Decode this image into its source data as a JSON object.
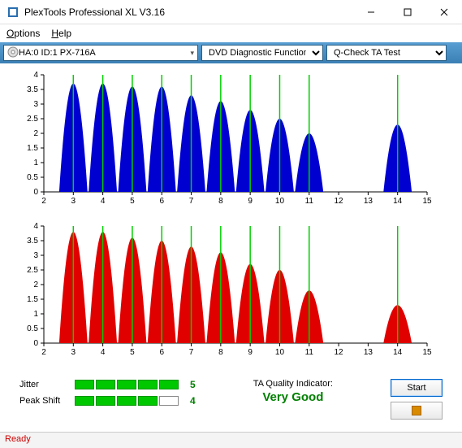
{
  "window": {
    "title": "PlexTools Professional XL V3.16"
  },
  "menu": {
    "options": "Options",
    "help": "Help"
  },
  "toolbar": {
    "drive": "HA:0 ID:1  PX-716A",
    "func": "DVD Diagnostic Functions",
    "test": "Q-Check TA Test"
  },
  "metrics": {
    "jitter_label": "Jitter",
    "jitter_segments": 5,
    "jitter_value": "5",
    "peakshift_label": "Peak Shift",
    "peakshift_segments": 4,
    "peakshift_value": "4",
    "qi_label": "TA Quality Indicator:",
    "qi_value": "Very Good"
  },
  "buttons": {
    "start": "Start"
  },
  "status": "Ready",
  "chart_data": [
    {
      "type": "bar",
      "title": "",
      "xlabel": "",
      "ylabel": "",
      "xlim": [
        2,
        15
      ],
      "ylim": [
        0,
        4
      ],
      "xticks": [
        2,
        3,
        4,
        5,
        6,
        7,
        8,
        9,
        10,
        11,
        12,
        13,
        14,
        15
      ],
      "yticks": [
        0,
        0.5,
        1,
        1.5,
        2,
        2.5,
        3,
        3.5,
        4
      ],
      "color": "#0000d0",
      "markers_x": [
        3,
        4,
        5,
        6,
        7,
        8,
        9,
        10,
        11,
        14
      ],
      "peaks": [
        {
          "x": 3,
          "h": 3.7
        },
        {
          "x": 4,
          "h": 3.7
        },
        {
          "x": 5,
          "h": 3.6
        },
        {
          "x": 6,
          "h": 3.6
        },
        {
          "x": 7,
          "h": 3.3
        },
        {
          "x": 8,
          "h": 3.1
        },
        {
          "x": 9,
          "h": 2.8
        },
        {
          "x": 10,
          "h": 2.5
        },
        {
          "x": 11,
          "h": 2.0
        },
        {
          "x": 14,
          "h": 2.3
        }
      ]
    },
    {
      "type": "bar",
      "title": "",
      "xlabel": "",
      "ylabel": "",
      "xlim": [
        2,
        15
      ],
      "ylim": [
        0,
        4
      ],
      "xticks": [
        2,
        3,
        4,
        5,
        6,
        7,
        8,
        9,
        10,
        11,
        12,
        13,
        14,
        15
      ],
      "yticks": [
        0,
        0.5,
        1,
        1.5,
        2,
        2.5,
        3,
        3.5,
        4
      ],
      "color": "#e00000",
      "markers_x": [
        3,
        4,
        5,
        6,
        7,
        8,
        9,
        10,
        11,
        14
      ],
      "peaks": [
        {
          "x": 3,
          "h": 3.8
        },
        {
          "x": 4,
          "h": 3.8
        },
        {
          "x": 5,
          "h": 3.6
        },
        {
          "x": 6,
          "h": 3.5
        },
        {
          "x": 7,
          "h": 3.3
        },
        {
          "x": 8,
          "h": 3.1
        },
        {
          "x": 9,
          "h": 2.7
        },
        {
          "x": 10,
          "h": 2.5
        },
        {
          "x": 11,
          "h": 1.8
        },
        {
          "x": 14,
          "h": 1.3
        }
      ]
    }
  ]
}
